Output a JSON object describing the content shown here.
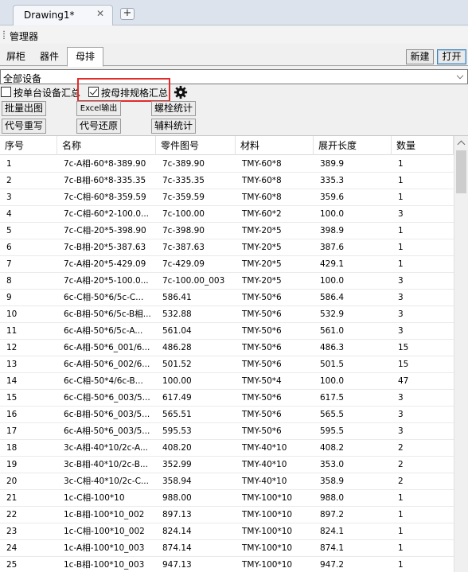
{
  "doc_tab": {
    "title": "Drawing1*",
    "close_glyph": "✕",
    "new_glyph": "+"
  },
  "panel": {
    "title": "管理器"
  },
  "sub_tabs": [
    "屏柜",
    "器件",
    "母排"
  ],
  "actions": {
    "new": "新建",
    "open": "打开"
  },
  "device_select": {
    "value": "全部设备"
  },
  "options": {
    "single_device_summary": {
      "label": "按单台设备汇总",
      "checked": false
    },
    "busbar_spec_summary": {
      "label": "按母排规格汇总",
      "checked": true
    },
    "settings_icon": "gear-icon"
  },
  "toolbar": {
    "batch_export": "批量出图",
    "excel_export": "Excel输出",
    "bolt_stats": "螺栓统计",
    "code_rewrite": "代号重写",
    "code_restore": "代号还原",
    "aux_stats": "辅料统计"
  },
  "grid": {
    "columns": [
      "序号",
      "名称",
      "零件图号",
      "材料",
      "展开长度",
      "数量"
    ],
    "rows": [
      [
        "1",
        "7c-A相-60*8-389.90",
        "7c-389.90",
        "TMY-60*8",
        "389.9",
        "1"
      ],
      [
        "2",
        "7c-B相-60*8-335.35",
        "7c-335.35",
        "TMY-60*8",
        "335.3",
        "1"
      ],
      [
        "3",
        "7c-C相-60*8-359.59",
        "7c-359.59",
        "TMY-60*8",
        "359.6",
        "1"
      ],
      [
        "4",
        "7c-C相-60*2-100.0...",
        "7c-100.00",
        "TMY-60*2",
        "100.0",
        "3"
      ],
      [
        "5",
        "7c-C相-20*5-398.90",
        "7c-398.90",
        "TMY-20*5",
        "398.9",
        "1"
      ],
      [
        "6",
        "7c-B相-20*5-387.63",
        "7c-387.63",
        "TMY-20*5",
        "387.6",
        "1"
      ],
      [
        "7",
        "7c-A相-20*5-429.09",
        "7c-429.09",
        "TMY-20*5",
        "429.1",
        "1"
      ],
      [
        "8",
        "7c-A相-20*5-100.0...",
        "7c-100.00_003",
        "TMY-20*5",
        "100.0",
        "3"
      ],
      [
        "9",
        "6c-C相-50*6/5c-C...",
        "586.41",
        "TMY-50*6",
        "586.4",
        "3"
      ],
      [
        "10",
        "6c-B相-50*6/5c-B相...",
        "532.88",
        "TMY-50*6",
        "532.9",
        "3"
      ],
      [
        "11",
        "6c-A相-50*6/5c-A...",
        "561.04",
        "TMY-50*6",
        "561.0",
        "3"
      ],
      [
        "12",
        "6c-A相-50*6_001/6...",
        "486.28",
        "TMY-50*6",
        "486.3",
        "15"
      ],
      [
        "13",
        "6c-A相-50*6_002/6...",
        "501.52",
        "TMY-50*6",
        "501.5",
        "15"
      ],
      [
        "14",
        "6c-C相-50*4/6c-B...",
        "100.00",
        "TMY-50*4",
        "100.0",
        "47"
      ],
      [
        "15",
        "6c-C相-50*6_003/5...",
        "617.49",
        "TMY-50*6",
        "617.5",
        "3"
      ],
      [
        "16",
        "6c-B相-50*6_003/5...",
        "565.51",
        "TMY-50*6",
        "565.5",
        "3"
      ],
      [
        "17",
        "6c-A相-50*6_003/5...",
        "595.53",
        "TMY-50*6",
        "595.5",
        "3"
      ],
      [
        "18",
        "3c-A相-40*10/2c-A...",
        "408.20",
        "TMY-40*10",
        "408.2",
        "2"
      ],
      [
        "19",
        "3c-B相-40*10/2c-B...",
        "352.99",
        "TMY-40*10",
        "353.0",
        "2"
      ],
      [
        "20",
        "3c-C相-40*10/2c-C...",
        "358.94",
        "TMY-40*10",
        "358.9",
        "2"
      ],
      [
        "21",
        "1c-C相-100*10",
        "988.00",
        "TMY-100*10",
        "988.0",
        "1"
      ],
      [
        "22",
        "1c-B相-100*10_002",
        "897.13",
        "TMY-100*10",
        "897.2",
        "1"
      ],
      [
        "23",
        "1c-C相-100*10_002",
        "824.14",
        "TMY-100*10",
        "824.1",
        "1"
      ],
      [
        "24",
        "1c-A相-100*10_003",
        "874.14",
        "TMY-100*10",
        "874.1",
        "1"
      ],
      [
        "25",
        "1c-B相-100*10_003",
        "947.13",
        "TMY-100*10",
        "947.2",
        "1"
      ]
    ]
  },
  "colors": {
    "highlight": "#e32b2b",
    "tabbar": "#dce3ec"
  }
}
